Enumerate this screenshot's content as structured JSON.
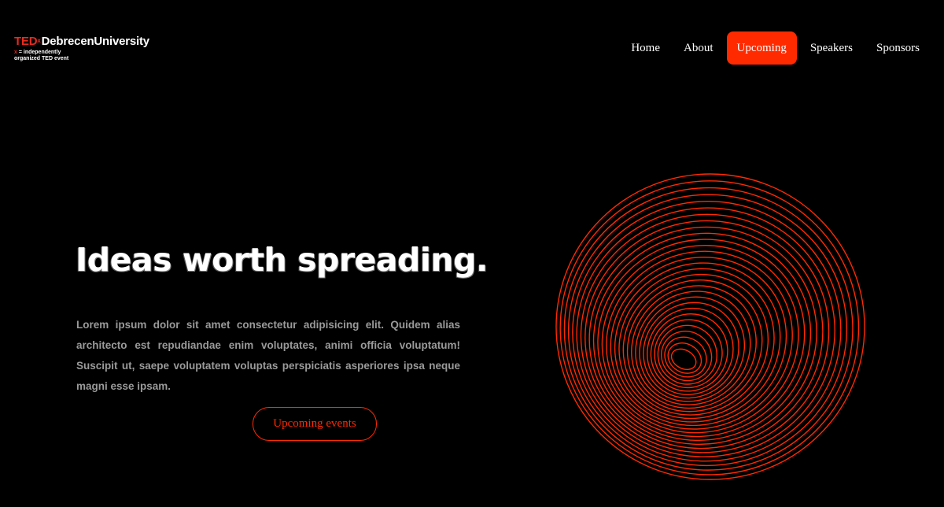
{
  "logo": {
    "ted": "TED",
    "x": "x",
    "name": "DebrecenUniversity",
    "sub_x": "x",
    "sub_line1": " = independently",
    "sub_line2": "organized TED event"
  },
  "nav": {
    "items": [
      {
        "label": "Home"
      },
      {
        "label": "About"
      },
      {
        "label": "Upcoming"
      },
      {
        "label": "Speakers"
      },
      {
        "label": "Sponsors"
      }
    ],
    "active_index": 2
  },
  "hero": {
    "title": "Ideas worth spreading.",
    "description": "Lorem ipsum dolor sit amet consectetur adipisicing elit. Quidem alias architecto est repudiandae enim voluptates, animi officia voluptatum! Suscipit ut, saepe voluptatem voluptas perspiciatis asperiores ipsa neque magni esse ipsam.",
    "cta_label": "Upcoming events"
  },
  "colors": {
    "accent": "#ff2a00",
    "ted_red": "#e62b1e",
    "background": "#000000",
    "text": "#ffffff",
    "muted_text": "#9a9a9a"
  },
  "icons": {
    "decoration": "red-spiral-sphere-graphic"
  }
}
